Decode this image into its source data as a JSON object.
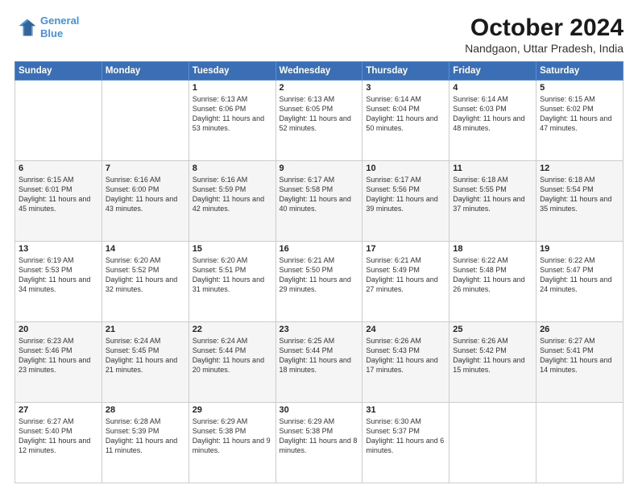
{
  "logo": {
    "line1": "General",
    "line2": "Blue"
  },
  "title": "October 2024",
  "location": "Nandgaon, Uttar Pradesh, India",
  "days_header": [
    "Sunday",
    "Monday",
    "Tuesday",
    "Wednesday",
    "Thursday",
    "Friday",
    "Saturday"
  ],
  "weeks": [
    [
      {
        "day": "",
        "sunrise": "",
        "sunset": "",
        "daylight": ""
      },
      {
        "day": "",
        "sunrise": "",
        "sunset": "",
        "daylight": ""
      },
      {
        "day": "1",
        "sunrise": "Sunrise: 6:13 AM",
        "sunset": "Sunset: 6:06 PM",
        "daylight": "Daylight: 11 hours and 53 minutes."
      },
      {
        "day": "2",
        "sunrise": "Sunrise: 6:13 AM",
        "sunset": "Sunset: 6:05 PM",
        "daylight": "Daylight: 11 hours and 52 minutes."
      },
      {
        "day": "3",
        "sunrise": "Sunrise: 6:14 AM",
        "sunset": "Sunset: 6:04 PM",
        "daylight": "Daylight: 11 hours and 50 minutes."
      },
      {
        "day": "4",
        "sunrise": "Sunrise: 6:14 AM",
        "sunset": "Sunset: 6:03 PM",
        "daylight": "Daylight: 11 hours and 48 minutes."
      },
      {
        "day": "5",
        "sunrise": "Sunrise: 6:15 AM",
        "sunset": "Sunset: 6:02 PM",
        "daylight": "Daylight: 11 hours and 47 minutes."
      }
    ],
    [
      {
        "day": "6",
        "sunrise": "Sunrise: 6:15 AM",
        "sunset": "Sunset: 6:01 PM",
        "daylight": "Daylight: 11 hours and 45 minutes."
      },
      {
        "day": "7",
        "sunrise": "Sunrise: 6:16 AM",
        "sunset": "Sunset: 6:00 PM",
        "daylight": "Daylight: 11 hours and 43 minutes."
      },
      {
        "day": "8",
        "sunrise": "Sunrise: 6:16 AM",
        "sunset": "Sunset: 5:59 PM",
        "daylight": "Daylight: 11 hours and 42 minutes."
      },
      {
        "day": "9",
        "sunrise": "Sunrise: 6:17 AM",
        "sunset": "Sunset: 5:58 PM",
        "daylight": "Daylight: 11 hours and 40 minutes."
      },
      {
        "day": "10",
        "sunrise": "Sunrise: 6:17 AM",
        "sunset": "Sunset: 5:56 PM",
        "daylight": "Daylight: 11 hours and 39 minutes."
      },
      {
        "day": "11",
        "sunrise": "Sunrise: 6:18 AM",
        "sunset": "Sunset: 5:55 PM",
        "daylight": "Daylight: 11 hours and 37 minutes."
      },
      {
        "day": "12",
        "sunrise": "Sunrise: 6:18 AM",
        "sunset": "Sunset: 5:54 PM",
        "daylight": "Daylight: 11 hours and 35 minutes."
      }
    ],
    [
      {
        "day": "13",
        "sunrise": "Sunrise: 6:19 AM",
        "sunset": "Sunset: 5:53 PM",
        "daylight": "Daylight: 11 hours and 34 minutes."
      },
      {
        "day": "14",
        "sunrise": "Sunrise: 6:20 AM",
        "sunset": "Sunset: 5:52 PM",
        "daylight": "Daylight: 11 hours and 32 minutes."
      },
      {
        "day": "15",
        "sunrise": "Sunrise: 6:20 AM",
        "sunset": "Sunset: 5:51 PM",
        "daylight": "Daylight: 11 hours and 31 minutes."
      },
      {
        "day": "16",
        "sunrise": "Sunrise: 6:21 AM",
        "sunset": "Sunset: 5:50 PM",
        "daylight": "Daylight: 11 hours and 29 minutes."
      },
      {
        "day": "17",
        "sunrise": "Sunrise: 6:21 AM",
        "sunset": "Sunset: 5:49 PM",
        "daylight": "Daylight: 11 hours and 27 minutes."
      },
      {
        "day": "18",
        "sunrise": "Sunrise: 6:22 AM",
        "sunset": "Sunset: 5:48 PM",
        "daylight": "Daylight: 11 hours and 26 minutes."
      },
      {
        "day": "19",
        "sunrise": "Sunrise: 6:22 AM",
        "sunset": "Sunset: 5:47 PM",
        "daylight": "Daylight: 11 hours and 24 minutes."
      }
    ],
    [
      {
        "day": "20",
        "sunrise": "Sunrise: 6:23 AM",
        "sunset": "Sunset: 5:46 PM",
        "daylight": "Daylight: 11 hours and 23 minutes."
      },
      {
        "day": "21",
        "sunrise": "Sunrise: 6:24 AM",
        "sunset": "Sunset: 5:45 PM",
        "daylight": "Daylight: 11 hours and 21 minutes."
      },
      {
        "day": "22",
        "sunrise": "Sunrise: 6:24 AM",
        "sunset": "Sunset: 5:44 PM",
        "daylight": "Daylight: 11 hours and 20 minutes."
      },
      {
        "day": "23",
        "sunrise": "Sunrise: 6:25 AM",
        "sunset": "Sunset: 5:44 PM",
        "daylight": "Daylight: 11 hours and 18 minutes."
      },
      {
        "day": "24",
        "sunrise": "Sunrise: 6:26 AM",
        "sunset": "Sunset: 5:43 PM",
        "daylight": "Daylight: 11 hours and 17 minutes."
      },
      {
        "day": "25",
        "sunrise": "Sunrise: 6:26 AM",
        "sunset": "Sunset: 5:42 PM",
        "daylight": "Daylight: 11 hours and 15 minutes."
      },
      {
        "day": "26",
        "sunrise": "Sunrise: 6:27 AM",
        "sunset": "Sunset: 5:41 PM",
        "daylight": "Daylight: 11 hours and 14 minutes."
      }
    ],
    [
      {
        "day": "27",
        "sunrise": "Sunrise: 6:27 AM",
        "sunset": "Sunset: 5:40 PM",
        "daylight": "Daylight: 11 hours and 12 minutes."
      },
      {
        "day": "28",
        "sunrise": "Sunrise: 6:28 AM",
        "sunset": "Sunset: 5:39 PM",
        "daylight": "Daylight: 11 hours and 11 minutes."
      },
      {
        "day": "29",
        "sunrise": "Sunrise: 6:29 AM",
        "sunset": "Sunset: 5:38 PM",
        "daylight": "Daylight: 11 hours and 9 minutes."
      },
      {
        "day": "30",
        "sunrise": "Sunrise: 6:29 AM",
        "sunset": "Sunset: 5:38 PM",
        "daylight": "Daylight: 11 hours and 8 minutes."
      },
      {
        "day": "31",
        "sunrise": "Sunrise: 6:30 AM",
        "sunset": "Sunset: 5:37 PM",
        "daylight": "Daylight: 11 hours and 6 minutes."
      },
      {
        "day": "",
        "sunrise": "",
        "sunset": "",
        "daylight": ""
      },
      {
        "day": "",
        "sunrise": "",
        "sunset": "",
        "daylight": ""
      }
    ]
  ]
}
